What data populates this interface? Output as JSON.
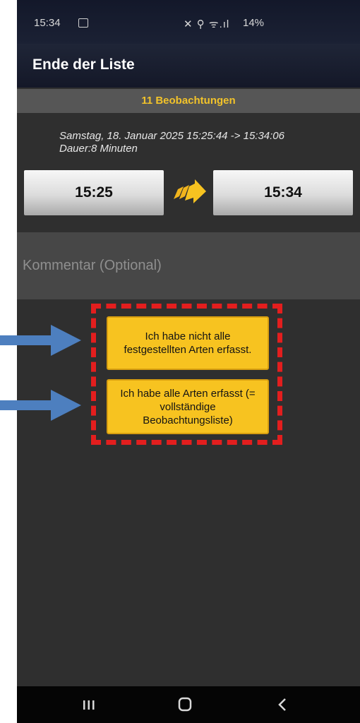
{
  "status_bar": {
    "time": "15:34",
    "icons": "✕ ⚲ ᯤ.ıl",
    "battery": "14%"
  },
  "header": {
    "title": "Ende der Liste"
  },
  "summary": {
    "count_label": "11 Beobachtungen",
    "date_range": "Samstag, 18. Januar 2025 15:25:44 -> 15:34:06",
    "duration": "Dauer:8 Minuten"
  },
  "times": {
    "start": "15:25",
    "end": "15:34"
  },
  "comment": {
    "placeholder": "Kommentar (Optional)"
  },
  "actions": {
    "incomplete": "Ich habe nicht alle festgestellten Arten erfasst.",
    "complete": "Ich habe alle Arten erfasst (= vollständige Beobachtungsliste)"
  },
  "icons": {
    "arrow": "arrow-right-icon",
    "nav": [
      "recents-icon",
      "home-icon",
      "back-icon"
    ],
    "annotation": "annotation-arrow-icon"
  },
  "colors": {
    "accent_yellow": "#f7c320",
    "highlight_red": "#e31e1e",
    "annotation_blue": "#4d7fbf",
    "count_text": "#f2c32a"
  }
}
